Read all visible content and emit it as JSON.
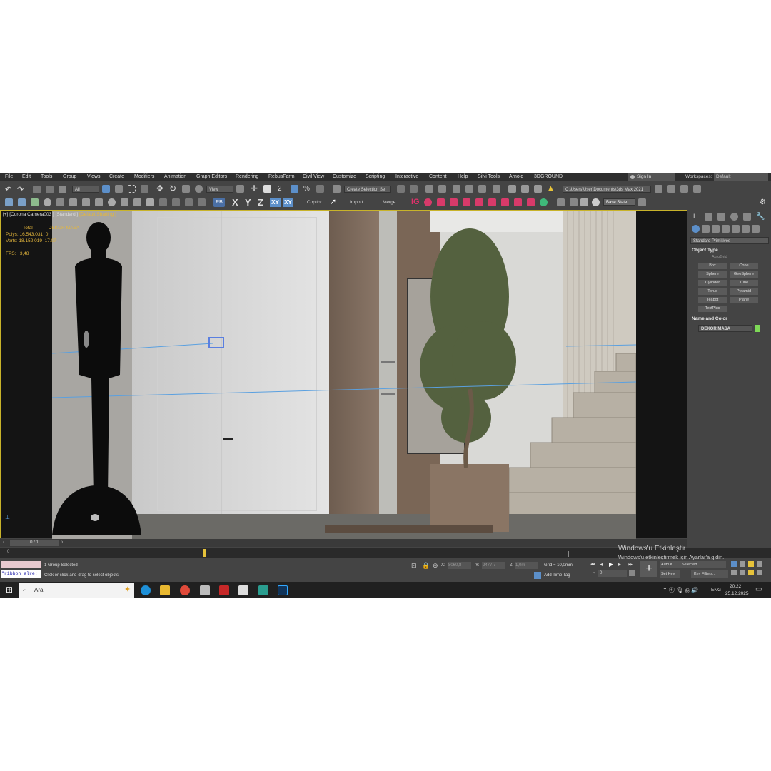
{
  "menu": {
    "items": [
      "File",
      "Edit",
      "Tools",
      "Group",
      "Views",
      "Create",
      "Modifiers",
      "Animation",
      "Graph Editors",
      "Rendering",
      "RebusFarm",
      "Civil View",
      "Customize",
      "Scripting",
      "Interactive",
      "Content",
      "Help",
      "SiNi Tools",
      "Arnold",
      "3DGROUND"
    ],
    "sign_in": "Sign In",
    "workspaces_label": "Workspaces:",
    "workspace_value": "Default"
  },
  "toolbar": {
    "filter_value": "All",
    "refcoord_value": "View",
    "selection_set_placeholder": "Create Selection Se",
    "path_value": "C:\\Users\\User\\Documents\\3ds Max 2021",
    "rb_label": "RB",
    "axis_x": "X",
    "axis_y": "Y",
    "axis_z": "Z",
    "axis_xy": "XY",
    "axis_xy2": "XY",
    "copitor": "Copitor",
    "import": "Import...",
    "merge": "Merge...",
    "base_state": "Base State"
  },
  "viewport": {
    "label_prefix": "[+] [Corona Camera003 ]",
    "label_standard": "[Standard ]",
    "label_shading": "[Default Shading ]",
    "stats": {
      "total_label": "Total",
      "total_value": "DEKOR MASA",
      "polys_label": "Polys:",
      "polys_value": "16.543.031",
      "polys_sel": "0",
      "verts_label": "Verts:",
      "verts_value": "18.152.019",
      "verts_sel": "17.07",
      "fps_label": "FPS:",
      "fps_value": "3,48"
    }
  },
  "command_panel": {
    "category": "Standard Primitives",
    "rollout_object_type": "Object Type",
    "autogrid": "AutoGrid",
    "buttons": [
      "Box",
      "Cone",
      "Sphere",
      "GeoSphere",
      "Cylinder",
      "Tube",
      "Torus",
      "Pyramid",
      "Teapot",
      "Plane",
      "TextPlus"
    ],
    "rollout_name_color": "Name and Color",
    "object_name": "DEKOR MASA",
    "object_color": "#7ed957"
  },
  "timeline": {
    "frame": "0 / 1",
    "tick": "0"
  },
  "status": {
    "maxscript": "\"ribbon alre:",
    "selected": "1 Group Selected",
    "prompt": "Click or click-and-drag to select objects",
    "x_label": "X:",
    "x_value": "8060,8",
    "y_label": "Y:",
    "y_value": "2477,7",
    "z_label": "Z:",
    "z_value": "1,0m",
    "grid": "Grid = 10,0mm",
    "add_time_tag": "Add Time Tag",
    "auto_key": "Auto K.",
    "set_key": "Set Key",
    "key_filters": "Key Filters...",
    "selected_dropdown": "Selected",
    "frame_field": "0"
  },
  "watermark": {
    "line1": "Windows'u Etkinleştir",
    "line2": "Windows'u etkinleştirmek için Ayarlar'a gidin."
  },
  "taskbar": {
    "search_label": "Ara",
    "lang": "ENG",
    "time": "20:22",
    "date": "25.12.2025"
  }
}
